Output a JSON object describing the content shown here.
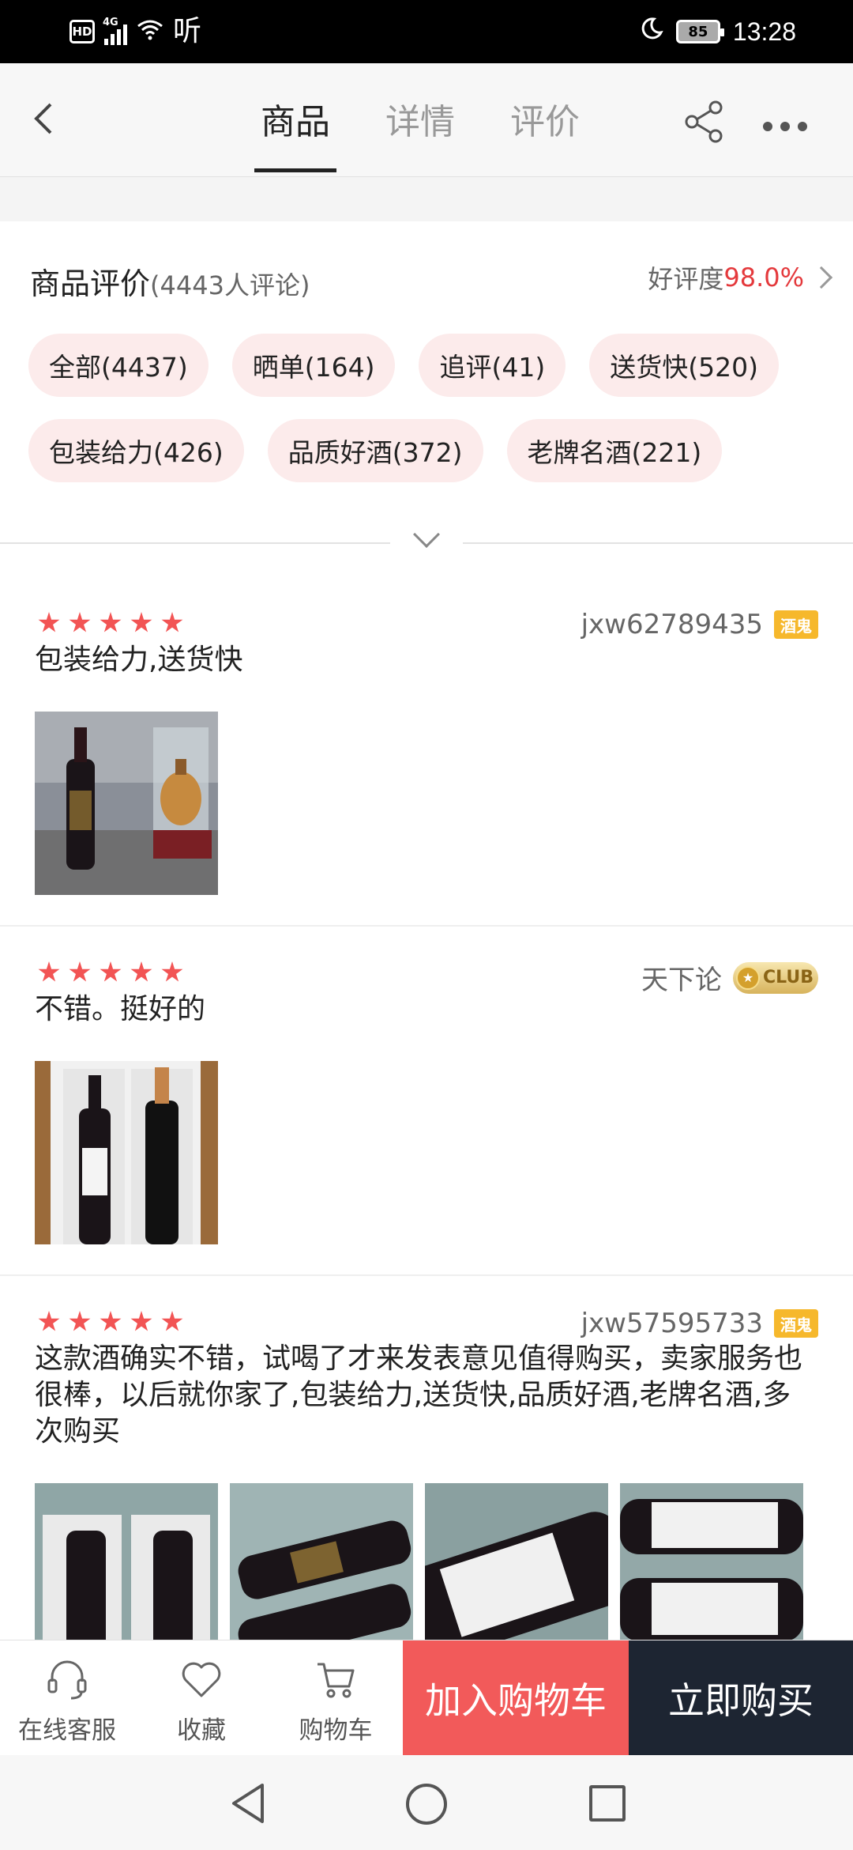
{
  "status_bar": {
    "time": "13:28",
    "battery": "85",
    "network": "4G",
    "hd": "HD",
    "app_glyph": "听"
  },
  "nav": {
    "tabs": [
      {
        "label": "商品",
        "active": true
      },
      {
        "label": "详情",
        "active": false
      },
      {
        "label": "评价",
        "active": false
      }
    ]
  },
  "summary": {
    "title": "商品评价",
    "count": "(4443人评论)",
    "rating_label": "好评度",
    "rating_value": "98.0%"
  },
  "tags": [
    "全部(4437)",
    "晒单(164)",
    "追评(41)",
    "送货快(520)",
    "包装给力(426)",
    "品质好酒(372)",
    "老牌名酒(221)"
  ],
  "reviews": [
    {
      "user": "jxw62789435",
      "badge": "酒鬼",
      "stars": 5,
      "text": "包装给力,送货快",
      "photo_count": 1
    },
    {
      "user": "天下论",
      "badge": "CLUB",
      "stars": 5,
      "text": "不错。挺好的",
      "photo_count": 1
    },
    {
      "user": "jxw57595733",
      "badge": "酒鬼",
      "stars": 5,
      "text": "这款酒确实不错，试喝了才来发表意见值得购买，卖家服务也很棒，以后就你家了,包装给力,送货快,品质好酒,老牌名酒,多次购买",
      "photo_count": 4
    }
  ],
  "action_bar": {
    "service_label": "在线客服",
    "favorite_label": "收藏",
    "cart_label": "购物车",
    "add_to_cart_label": "加入购物车",
    "buy_now_label": "立即购买"
  },
  "colors": {
    "accent_red": "#e4393c",
    "cart_button": "#f25a5a",
    "buy_button": "#1d2532",
    "star": "#f25454",
    "tag_bg": "#fcebeb"
  }
}
